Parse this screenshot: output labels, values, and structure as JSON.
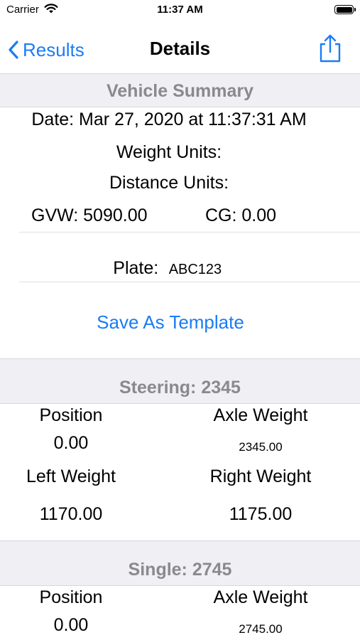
{
  "status_bar": {
    "carrier": "Carrier",
    "time": "11:37 AM"
  },
  "nav": {
    "back_label": "Results",
    "title": "Details"
  },
  "summary": {
    "header": "Vehicle Summary",
    "date": "Date: Mar 27, 2020 at 11:37:31 AM",
    "weight_units": "Weight Units:",
    "distance_units": "Distance Units:",
    "gvw": "GVW: 5090.00",
    "cg": "CG: 0.00",
    "plate_label": "Plate:",
    "plate_value": "ABC123",
    "save_template": "Save As Template"
  },
  "axles": [
    {
      "header": "Steering: 2345",
      "position_label": "Position",
      "position_value": "0.00",
      "axle_weight_label": "Axle Weight",
      "axle_weight_value": "2345.00",
      "left_weight_label": "Left Weight",
      "left_weight_value": "1170.00",
      "right_weight_label": "Right Weight",
      "right_weight_value": "1175.00"
    },
    {
      "header": "Single: 2745",
      "position_label": "Position",
      "position_value": "0.00",
      "axle_weight_label": "Axle Weight",
      "axle_weight_value": "2745.00"
    }
  ],
  "colors": {
    "accent": "#1a7cf5",
    "section_bg": "#efeff4",
    "section_text": "#8a8a8e"
  }
}
